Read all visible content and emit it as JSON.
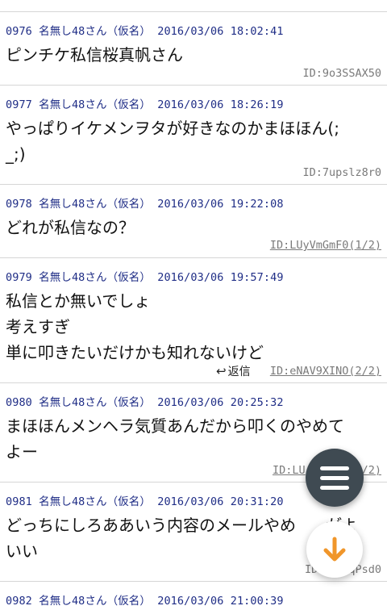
{
  "posts": [
    {
      "meta": "0976 名無し48さん（仮名） 2016/03/06 18:02:41",
      "body": "ピンチケ私信桜真帆さん",
      "id": "ID:9o3SSAX50"
    },
    {
      "meta": "0977 名無し48さん（仮名） 2016/03/06 18:26:19",
      "body": "やっぱりイケメンヲタが好きなのかまほほん(;\n_;)",
      "id": "ID:7upslz8r0"
    },
    {
      "meta": "0978 名無し48さん（仮名） 2016/03/06 19:22:08",
      "body": "どれが私信なの？",
      "id": "ID:LUyVmGmF0(1/2)"
    },
    {
      "meta": "0979 名無し48さん（仮名） 2016/03/06 19:57:49",
      "body": "私信とか無いでしょ\n考えすぎ\n単に叩きたいだけかも知れないけど",
      "id": "ID:eNAV9XINO(2/2)",
      "reply": "返信"
    },
    {
      "meta": "0980 名無し48さん（仮名） 2016/03/06 20:25:32",
      "body": "まほほんメンヘラ気質あんだから叩くのやめて\nよー",
      "id": "ID:LU"
    },
    {
      "meta": "0981 名無し48さん（仮名） 2016/03/06 20:31:20",
      "body": "どっちにしろああいう内容のメールやめ\nいい",
      "id": "qPsd0",
      "id_prefix": "ID"
    },
    {
      "meta": "0982 名無し48さん（仮名） 2016/03/06 21:00:39"
    }
  ],
  "partial_text": {
    "p980_id_tail": "/2)",
    "p981_body_tail": "がよ"
  },
  "icons": {
    "reply": "reply-arrow-icon",
    "menu": "hamburger-menu-icon",
    "down": "arrow-down-icon"
  },
  "colors": {
    "meta": "#1f2d86",
    "id": "#7a7a7a",
    "fab_menu": "#3f4a52",
    "fab_down_arrow": "#f0962a"
  }
}
